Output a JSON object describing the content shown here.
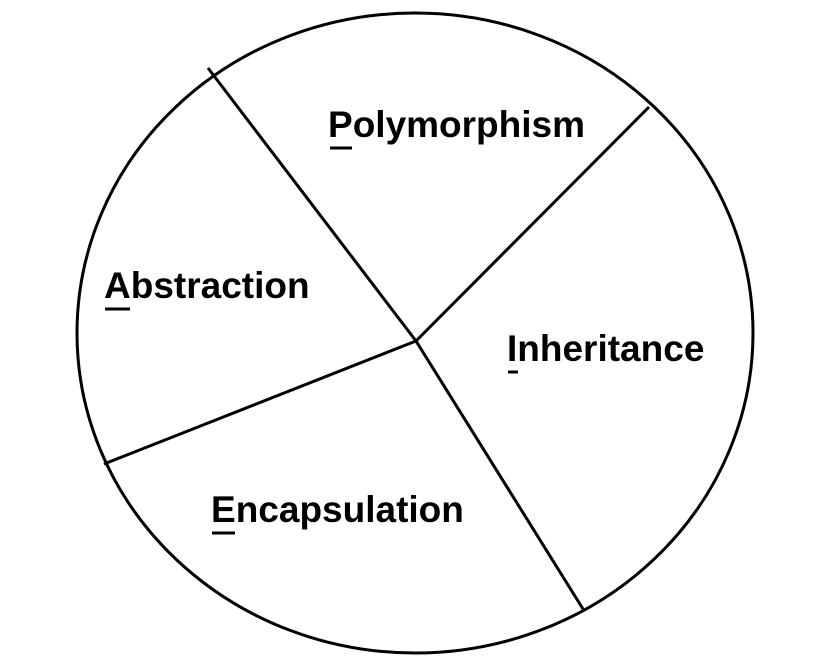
{
  "diagram": {
    "segments": [
      {
        "id": "polymorphism",
        "initial": "P",
        "rest": "olymorphism"
      },
      {
        "id": "abstraction",
        "initial": "A",
        "rest": "bstraction"
      },
      {
        "id": "inheritance",
        "initial": "I",
        "rest": "nheritance"
      },
      {
        "id": "encapsulation",
        "initial": "E",
        "rest": "ncapsulation"
      }
    ]
  }
}
